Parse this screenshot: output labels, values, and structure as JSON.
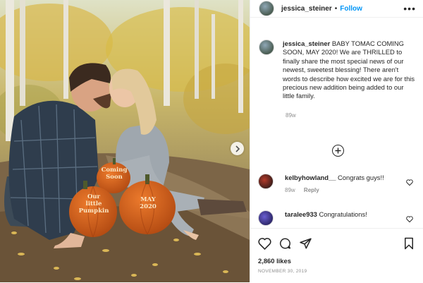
{
  "post": {
    "username": "jessica_steiner",
    "follow_label": "Follow",
    "dot": "•",
    "more": "•••",
    "caption_text": "BABY TOMAC COMING SOON, MAY 2020! We are THRILLED to finally share the most special news of our newest, sweetest blessing! There aren't words to describe how excited we are for this precious new addition being added to our little family.",
    "caption_time": "89w",
    "likes": "2,860 likes",
    "date": "NOVEMBER 30, 2019"
  },
  "pumpkins": {
    "small": "Coming\nSoon",
    "left": "Our\nlittle\nPumpkin",
    "right": "MAY\n2020"
  },
  "comments": [
    {
      "username": "kelbyhowland__",
      "text": "Congrats guys!!",
      "time": "89w",
      "reply": "Reply"
    },
    {
      "username": "taralee933",
      "text": "Congratulations!",
      "time": "",
      "reply": ""
    }
  ],
  "icons": {
    "more": "more-options-icon",
    "next": "chevron-right-icon",
    "load_more": "plus-circle-icon",
    "like": "heart-icon",
    "comment": "comment-icon",
    "share": "share-icon",
    "save": "bookmark-icon"
  },
  "colors": {
    "follow": "#0095f6",
    "meta": "#8e8e8e",
    "pumpkin": "#d8641f"
  }
}
